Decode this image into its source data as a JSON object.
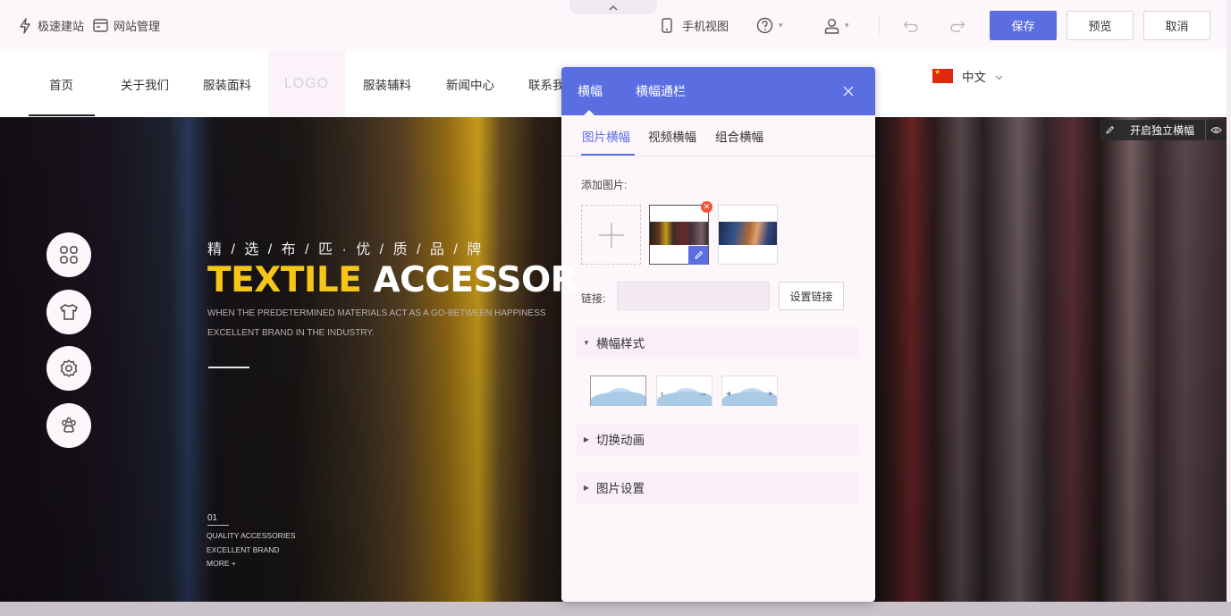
{
  "editor": {
    "quick_build": "极速建站",
    "site_manage": "网站管理",
    "mobile_view": "手机视图",
    "save": "保存",
    "preview": "预览",
    "cancel": "取消"
  },
  "nav": {
    "items": [
      "首页",
      "关于我们",
      "服装面料",
      "服装辅料",
      "新闻中心",
      "联系我"
    ],
    "logo": "LOGO",
    "language": "中文"
  },
  "banner": {
    "slogan_cn": "精 / 选 / 布 / 匹 · 优 / 质 / 品 / 牌",
    "headline_part1": "TEXTILE",
    "headline_part2": "ACCESSOR",
    "sub_line1": "WHEN THE PREDETERMINED MATERIALS ACT AS A GO-BETWEEN HAPPINESS",
    "sub_line2": "EXCELLENT BRAND IN THE INDUSTRY.",
    "slide_number": "01",
    "small_line1": "QUALITY ACCESSORIES",
    "small_line2": "EXCELLENT BRAND",
    "small_line3": "MORE +",
    "independent_banner": "开启独立横幅",
    "side_icons": [
      "grid-icon",
      "tshirt-icon",
      "gear-icon",
      "paw-icon"
    ]
  },
  "panel": {
    "tab_banner": "横幅",
    "tab_banner_bar": "横幅通栏",
    "sub_tabs": [
      "图片横幅",
      "视频横幅",
      "组合横幅"
    ],
    "add_image_label": "添加图片:",
    "link_label": "链接:",
    "set_link": "设置链接",
    "section_style": "横幅样式",
    "section_transition": "切换动画",
    "section_image_settings": "图片设置"
  },
  "colors": {
    "accent": "#5b6ee1",
    "headline_yellow": "#f5c518",
    "delete_red": "#f0553a"
  }
}
